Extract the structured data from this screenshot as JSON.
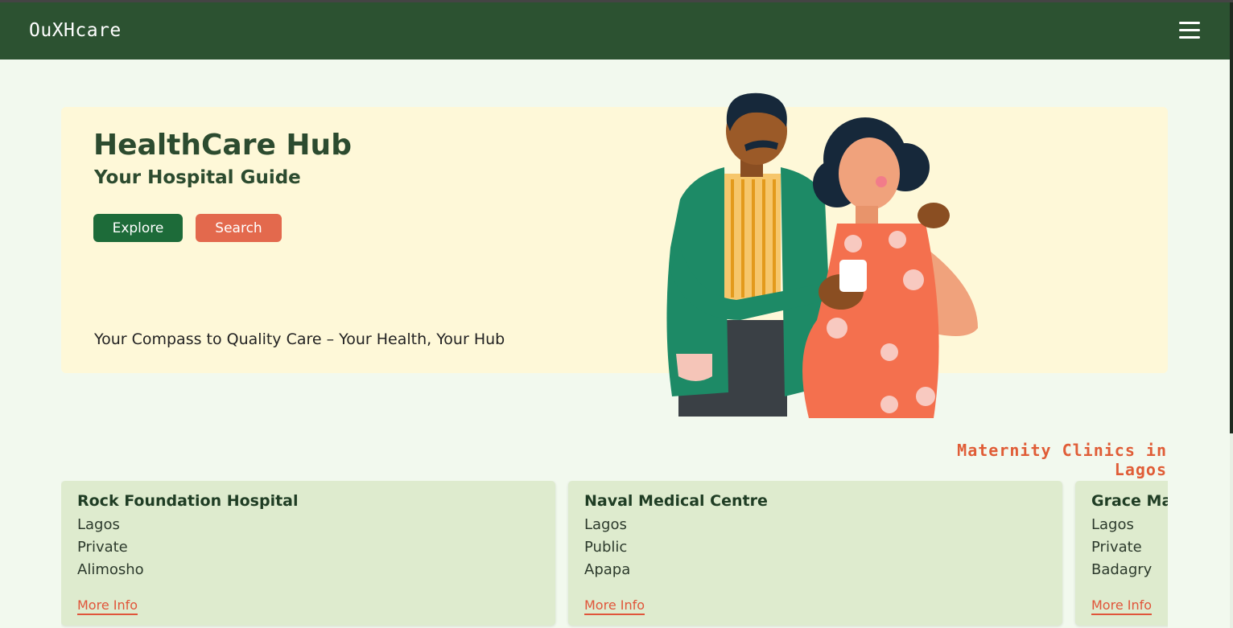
{
  "app": {
    "brand": "OuXHcare"
  },
  "navbar": {
    "menu_icon": "hamburger-icon"
  },
  "hero": {
    "title": "HealthCare Hub",
    "subtitle": "Your Hospital Guide",
    "explore_label": "Explore",
    "search_label": "Search",
    "tagline": "Your Compass to Quality Care – Your Health, Your Hub",
    "illustration": "couple-expecting-illustration"
  },
  "section": {
    "title": "Maternity Clinics in Lagos"
  },
  "clinics": [
    {
      "name": "Rock Foundation Hospital",
      "city": "Lagos",
      "type": "Private",
      "area": "Alimosho",
      "link": "More Info"
    },
    {
      "name": "Naval Medical Centre",
      "city": "Lagos",
      "type": "Public",
      "area": "Apapa",
      "link": "More Info"
    },
    {
      "name": "Grace Mat",
      "city": "Lagos",
      "type": "Private",
      "area": "Badagry",
      "link": "More Info"
    }
  ],
  "colors": {
    "navbar": "#2c5231",
    "hero_bg": "#fef8d8",
    "page_bg": "#f2f9ee",
    "card_bg": "#deebce",
    "primary_button": "#1d6b39",
    "secondary_button": "#e3694d",
    "accent": "#e05d37"
  }
}
